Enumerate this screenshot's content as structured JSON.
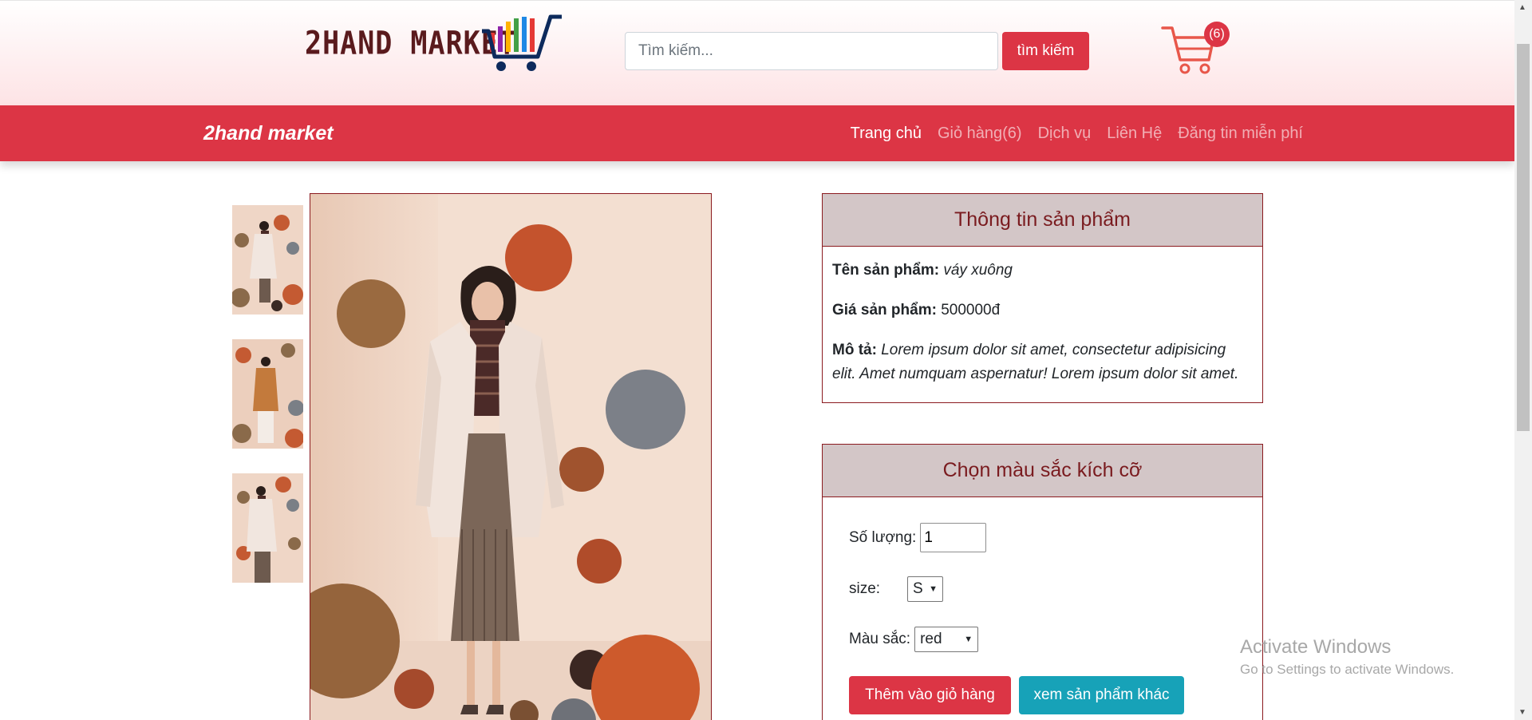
{
  "header": {
    "logo_text": "2HAND MARKET",
    "search": {
      "placeholder": "Tìm kiếm...",
      "value": ""
    },
    "search_button": "tìm kiếm",
    "cart_count": "(6)"
  },
  "navbar": {
    "brand": "2hand market",
    "links": [
      {
        "label": "Trang chủ",
        "active": true
      },
      {
        "label": "Giỏ hàng(6)",
        "active": false
      },
      {
        "label": "Dịch vụ",
        "active": false
      },
      {
        "label": "Liên Hệ",
        "active": false
      },
      {
        "label": "Đăng tin miễn phí",
        "active": false
      }
    ]
  },
  "product_info": {
    "heading": "Thông tin sản phẩm",
    "name_label": "Tên sản phẩm:",
    "name_value": "váy xuông",
    "price_label": "Giá sản phẩm:",
    "price_value": "500000đ",
    "desc_label": "Mô tả:",
    "desc_value": "Lorem ipsum dolor sit amet, consectetur adipisicing elit. Amet numquam aspernatur! Lorem ipsum dolor sit amet."
  },
  "options": {
    "heading": "Chọn màu sắc kích cỡ",
    "qty_label": "Số lượng:",
    "qty_value": "1",
    "size_label": "size:",
    "size_value": "S",
    "color_label": "Màu sắc:",
    "color_value": "red",
    "add_button": "Thêm vào giỏ hàng",
    "more_button": "xem sản phẩm khác"
  },
  "watermark": {
    "line1": "Activate Windows",
    "line2": "Go to Settings to activate Windows."
  },
  "colors": {
    "primary_red": "#dc3545",
    "info_teal": "#17a2b8",
    "panel_head_bg": "#d3c6c7",
    "panel_border": "#8b1a1f"
  }
}
